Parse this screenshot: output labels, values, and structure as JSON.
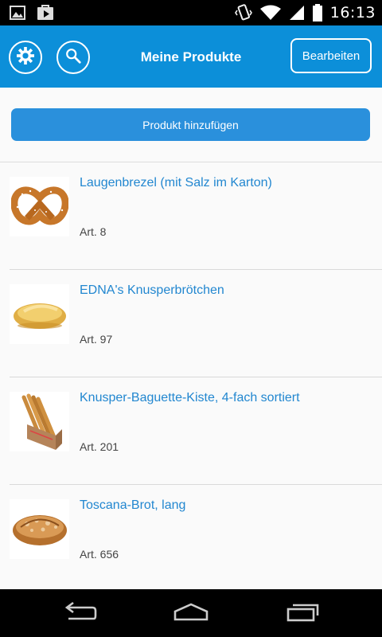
{
  "status_bar": {
    "time": "16:13",
    "icons": [
      "image-notification-icon",
      "play-store-notification-icon",
      "vibrate-icon",
      "wifi-icon",
      "signal-icon",
      "battery-icon"
    ]
  },
  "app_bar": {
    "title": "Meine Produkte",
    "edit_label": "Bearbeiten",
    "icons": [
      "gear-icon",
      "search-icon"
    ],
    "color": "#0c8fd9"
  },
  "add_button": {
    "label": "Produkt hinzufügen",
    "color": "#2a90dc"
  },
  "products": [
    {
      "name": "Laugenbrezel (mit Salz im Karton)",
      "article": "Art. 8",
      "image": "pretzel"
    },
    {
      "name": "EDNA's Knusperbrötchen",
      "article": "Art. 97",
      "image": "bread-roll"
    },
    {
      "name": "Knusper-Baguette-Kiste, 4-fach sortiert",
      "article": "Art. 201",
      "image": "baguette-box"
    },
    {
      "name": "Toscana-Brot, lang",
      "article": "Art. 656",
      "image": "bread-loaf"
    }
  ],
  "nav_bar": {
    "icons": [
      "back-icon",
      "home-icon",
      "recents-icon"
    ]
  }
}
